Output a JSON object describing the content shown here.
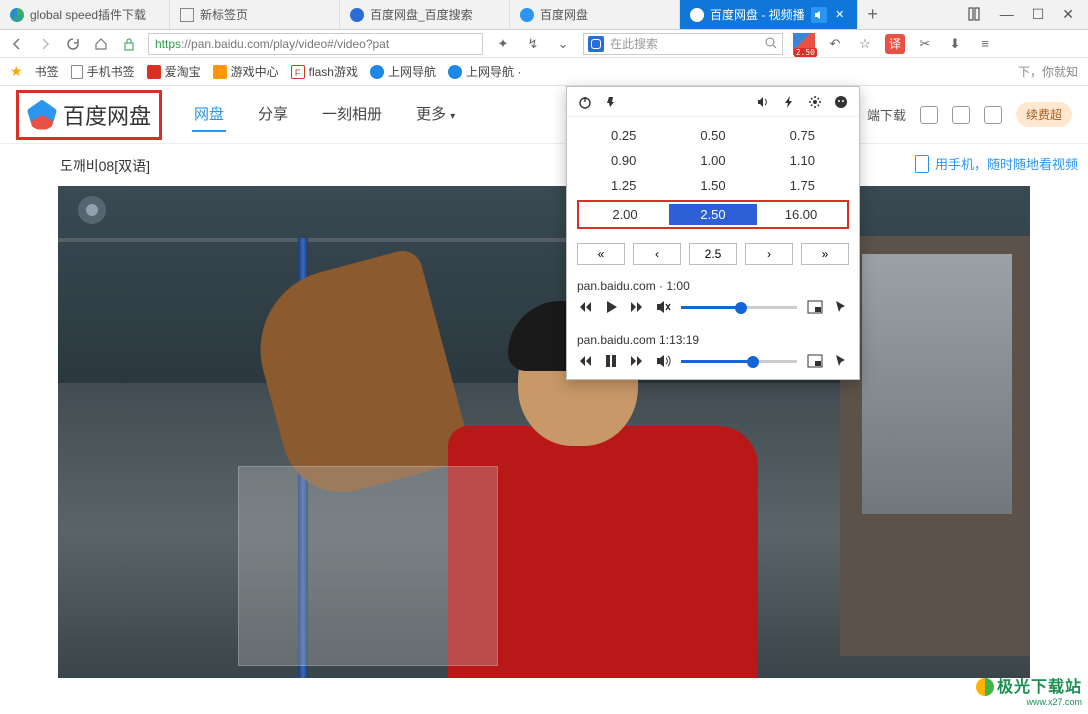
{
  "tabs": {
    "t0": "global speed插件下载",
    "t1": "新标签页",
    "t2": "百度网盘_百度搜索",
    "t3": "百度网盘",
    "t4": "百度网盘 - 视频播"
  },
  "addr": {
    "proto": "https",
    "host": "://pan.baidu.com",
    "path": "/play/video#/video?pat",
    "searchPlaceholder": "在此搜索",
    "speedBadge": "2.50"
  },
  "bookmarks": {
    "b0": "书签",
    "b1": "手机书签",
    "b2": "爱淘宝",
    "b3": "游戏中心",
    "b4": "flash游戏",
    "b5": "上网导航",
    "b6": "上网导航 ·",
    "tail": "下，你就知"
  },
  "pan": {
    "logo": "百度网盘",
    "nav0": "网盘",
    "nav1": "分享",
    "nav2": "一刻相册",
    "nav3": "更多",
    "dl": "端下载",
    "vip": "续费超"
  },
  "mobile_hint": "用手机，随时随地看视频",
  "video_title": "도깨비08[双语]",
  "popup": {
    "row0": {
      "c0": "0.25",
      "c1": "0.50",
      "c2": "0.75"
    },
    "row1": {
      "c0": "0.90",
      "c1": "1.00",
      "c2": "1.10"
    },
    "row2": {
      "c0": "1.25",
      "c1": "1.50",
      "c2": "1.75"
    },
    "row3": {
      "c0": "2.00",
      "c1": "2.50",
      "c2": "16.00"
    },
    "currentInput": "2.5",
    "media0_label": "pan.baidu.com · 1:00",
    "media1_label": "pan.baidu.com 1:13:19",
    "slider0_pct": 52,
    "slider1_pct": 62
  },
  "translate_label": "译",
  "watermark": {
    "l1": "极光下载站",
    "l2": "www.x27.com"
  }
}
